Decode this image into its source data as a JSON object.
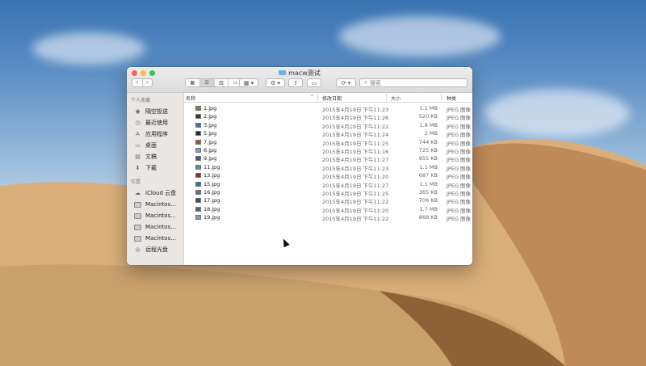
{
  "window": {
    "title": "macw测试",
    "traffic_light_colors": [
      "#fc605c",
      "#fdbc40",
      "#34c84a"
    ]
  },
  "toolbar": {
    "back_glyph": "‹",
    "forward_glyph": "›",
    "view_icons": [
      "icon-view-icon",
      "list-view-icon",
      "column-view-icon",
      "gallery-view-icon"
    ],
    "group_glyph": "▦ ▾",
    "action_glyph": "⚙ ▾",
    "share_glyph": "⇪",
    "tag_glyph": "▭",
    "dropbox_glyph": "⟳ ▾",
    "search_placeholder": "搜索"
  },
  "sidebar": {
    "favorites_header": "个人收藏",
    "favorites": [
      {
        "label": "隔空投送",
        "icon": "airdrop-icon"
      },
      {
        "label": "最近使用",
        "icon": "recents-icon"
      },
      {
        "label": "应用程序",
        "icon": "applications-icon"
      },
      {
        "label": "桌面",
        "icon": "desktop-icon"
      },
      {
        "label": "文稿",
        "icon": "documents-icon"
      },
      {
        "label": "下载",
        "icon": "downloads-icon"
      }
    ],
    "locations_header": "位置",
    "locations": [
      {
        "label": "iCloud 云盘",
        "icon": "icloud-icon"
      },
      {
        "label": "Macintos...",
        "icon": "disk-icon"
      },
      {
        "label": "Macintos...",
        "icon": "disk-icon"
      },
      {
        "label": "Macintos...",
        "icon": "disk-icon"
      },
      {
        "label": "Macintos...",
        "icon": "disk-icon"
      },
      {
        "label": "远程光盘",
        "icon": "remote-disc-icon"
      }
    ]
  },
  "columns": {
    "name": "名称",
    "sort_indicator": "^",
    "date": "修改日期",
    "size": "大小",
    "kind": "种类"
  },
  "files": [
    {
      "name": "1.jpg",
      "date": "2015年4月19日 下午11:23",
      "size": "1.1 MB",
      "kind": "JPEG 图像"
    },
    {
      "name": "2.jpg",
      "date": "2015年4月19日 下午11:26",
      "size": "520 KB",
      "kind": "JPEG 图像"
    },
    {
      "name": "3.jpg",
      "date": "2015年4月19日 下午11:22",
      "size": "1.8 MB",
      "kind": "JPEG 图像"
    },
    {
      "name": "5.jpg",
      "date": "2015年4月19日 下午11:24",
      "size": "2 MB",
      "kind": "JPEG 图像"
    },
    {
      "name": "7.jpg",
      "date": "2015年4月19日 下午11:25",
      "size": "744 KB",
      "kind": "JPEG 图像"
    },
    {
      "name": "8.jpg",
      "date": "2015年4月19日 下午11:16",
      "size": "725 KB",
      "kind": "JPEG 图像"
    },
    {
      "name": "9.jpg",
      "date": "2015年4月19日 下午11:27",
      "size": "955 KB",
      "kind": "JPEG 图像"
    },
    {
      "name": "11.jpg",
      "date": "2015年4月19日 下午11:23",
      "size": "1.1 MB",
      "kind": "JPEG 图像"
    },
    {
      "name": "13.jpg",
      "date": "2015年4月19日 下午11:20",
      "size": "687 KB",
      "kind": "JPEG 图像"
    },
    {
      "name": "15.jpg",
      "date": "2015年4月19日 下午11:27",
      "size": "1.1 MB",
      "kind": "JPEG 图像"
    },
    {
      "name": "16.jpg",
      "date": "2015年4月19日 下午11:25",
      "size": "365 KB",
      "kind": "JPEG 图像"
    },
    {
      "name": "17.jpg",
      "date": "2015年4月19日 下午11:22",
      "size": "706 KB",
      "kind": "JPEG 图像"
    },
    {
      "name": "18.jpg",
      "date": "2015年4月19日 下午11:20",
      "size": "1.7 MB",
      "kind": "JPEG 图像"
    },
    {
      "name": "19.jpg",
      "date": "2015年4月19日 下午11:22",
      "size": "868 KB",
      "kind": "JPEG 图像"
    }
  ],
  "thumb_colors": [
    "#5d8a4a",
    "#3b3b3b",
    "#4a6fa8",
    "#2d2d2d",
    "#b04a3a",
    "#7d9cc4",
    "#3a5aa0",
    "#6a86a8",
    "#8a3030",
    "#2f6fb5",
    "#4a78a8",
    "#3b4f6a",
    "#556677",
    "#8899aa"
  ]
}
